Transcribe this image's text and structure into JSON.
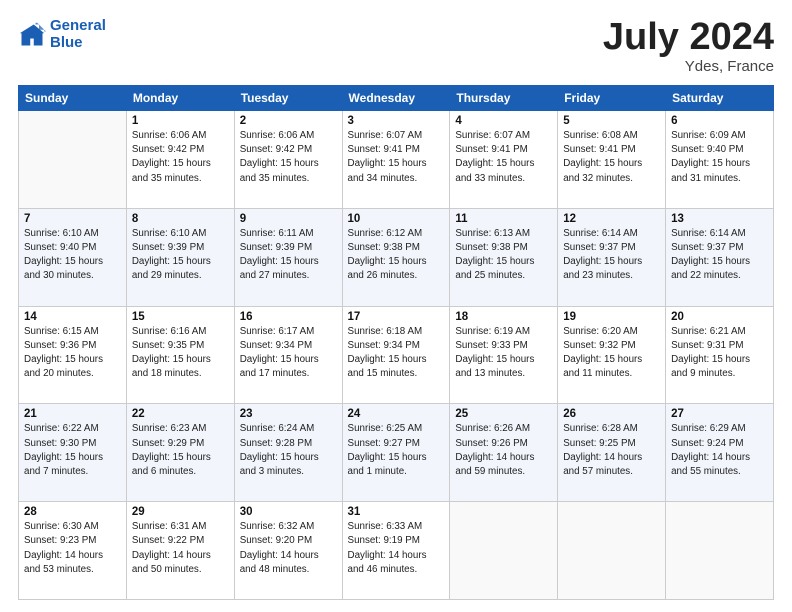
{
  "logo": {
    "line1": "General",
    "line2": "Blue"
  },
  "title": {
    "month_year": "July 2024",
    "location": "Ydes, France"
  },
  "days_of_week": [
    "Sunday",
    "Monday",
    "Tuesday",
    "Wednesday",
    "Thursday",
    "Friday",
    "Saturday"
  ],
  "weeks": [
    [
      {
        "day": "",
        "info": ""
      },
      {
        "day": "1",
        "info": "Sunrise: 6:06 AM\nSunset: 9:42 PM\nDaylight: 15 hours\nand 35 minutes."
      },
      {
        "day": "2",
        "info": "Sunrise: 6:06 AM\nSunset: 9:42 PM\nDaylight: 15 hours\nand 35 minutes."
      },
      {
        "day": "3",
        "info": "Sunrise: 6:07 AM\nSunset: 9:41 PM\nDaylight: 15 hours\nand 34 minutes."
      },
      {
        "day": "4",
        "info": "Sunrise: 6:07 AM\nSunset: 9:41 PM\nDaylight: 15 hours\nand 33 minutes."
      },
      {
        "day": "5",
        "info": "Sunrise: 6:08 AM\nSunset: 9:41 PM\nDaylight: 15 hours\nand 32 minutes."
      },
      {
        "day": "6",
        "info": "Sunrise: 6:09 AM\nSunset: 9:40 PM\nDaylight: 15 hours\nand 31 minutes."
      }
    ],
    [
      {
        "day": "7",
        "info": "Sunrise: 6:10 AM\nSunset: 9:40 PM\nDaylight: 15 hours\nand 30 minutes."
      },
      {
        "day": "8",
        "info": "Sunrise: 6:10 AM\nSunset: 9:39 PM\nDaylight: 15 hours\nand 29 minutes."
      },
      {
        "day": "9",
        "info": "Sunrise: 6:11 AM\nSunset: 9:39 PM\nDaylight: 15 hours\nand 27 minutes."
      },
      {
        "day": "10",
        "info": "Sunrise: 6:12 AM\nSunset: 9:38 PM\nDaylight: 15 hours\nand 26 minutes."
      },
      {
        "day": "11",
        "info": "Sunrise: 6:13 AM\nSunset: 9:38 PM\nDaylight: 15 hours\nand 25 minutes."
      },
      {
        "day": "12",
        "info": "Sunrise: 6:14 AM\nSunset: 9:37 PM\nDaylight: 15 hours\nand 23 minutes."
      },
      {
        "day": "13",
        "info": "Sunrise: 6:14 AM\nSunset: 9:37 PM\nDaylight: 15 hours\nand 22 minutes."
      }
    ],
    [
      {
        "day": "14",
        "info": "Sunrise: 6:15 AM\nSunset: 9:36 PM\nDaylight: 15 hours\nand 20 minutes."
      },
      {
        "day": "15",
        "info": "Sunrise: 6:16 AM\nSunset: 9:35 PM\nDaylight: 15 hours\nand 18 minutes."
      },
      {
        "day": "16",
        "info": "Sunrise: 6:17 AM\nSunset: 9:34 PM\nDaylight: 15 hours\nand 17 minutes."
      },
      {
        "day": "17",
        "info": "Sunrise: 6:18 AM\nSunset: 9:34 PM\nDaylight: 15 hours\nand 15 minutes."
      },
      {
        "day": "18",
        "info": "Sunrise: 6:19 AM\nSunset: 9:33 PM\nDaylight: 15 hours\nand 13 minutes."
      },
      {
        "day": "19",
        "info": "Sunrise: 6:20 AM\nSunset: 9:32 PM\nDaylight: 15 hours\nand 11 minutes."
      },
      {
        "day": "20",
        "info": "Sunrise: 6:21 AM\nSunset: 9:31 PM\nDaylight: 15 hours\nand 9 minutes."
      }
    ],
    [
      {
        "day": "21",
        "info": "Sunrise: 6:22 AM\nSunset: 9:30 PM\nDaylight: 15 hours\nand 7 minutes."
      },
      {
        "day": "22",
        "info": "Sunrise: 6:23 AM\nSunset: 9:29 PM\nDaylight: 15 hours\nand 6 minutes."
      },
      {
        "day": "23",
        "info": "Sunrise: 6:24 AM\nSunset: 9:28 PM\nDaylight: 15 hours\nand 3 minutes."
      },
      {
        "day": "24",
        "info": "Sunrise: 6:25 AM\nSunset: 9:27 PM\nDaylight: 15 hours\nand 1 minute."
      },
      {
        "day": "25",
        "info": "Sunrise: 6:26 AM\nSunset: 9:26 PM\nDaylight: 14 hours\nand 59 minutes."
      },
      {
        "day": "26",
        "info": "Sunrise: 6:28 AM\nSunset: 9:25 PM\nDaylight: 14 hours\nand 57 minutes."
      },
      {
        "day": "27",
        "info": "Sunrise: 6:29 AM\nSunset: 9:24 PM\nDaylight: 14 hours\nand 55 minutes."
      }
    ],
    [
      {
        "day": "28",
        "info": "Sunrise: 6:30 AM\nSunset: 9:23 PM\nDaylight: 14 hours\nand 53 minutes."
      },
      {
        "day": "29",
        "info": "Sunrise: 6:31 AM\nSunset: 9:22 PM\nDaylight: 14 hours\nand 50 minutes."
      },
      {
        "day": "30",
        "info": "Sunrise: 6:32 AM\nSunset: 9:20 PM\nDaylight: 14 hours\nand 48 minutes."
      },
      {
        "day": "31",
        "info": "Sunrise: 6:33 AM\nSunset: 9:19 PM\nDaylight: 14 hours\nand 46 minutes."
      },
      {
        "day": "",
        "info": ""
      },
      {
        "day": "",
        "info": ""
      },
      {
        "day": "",
        "info": ""
      }
    ]
  ]
}
